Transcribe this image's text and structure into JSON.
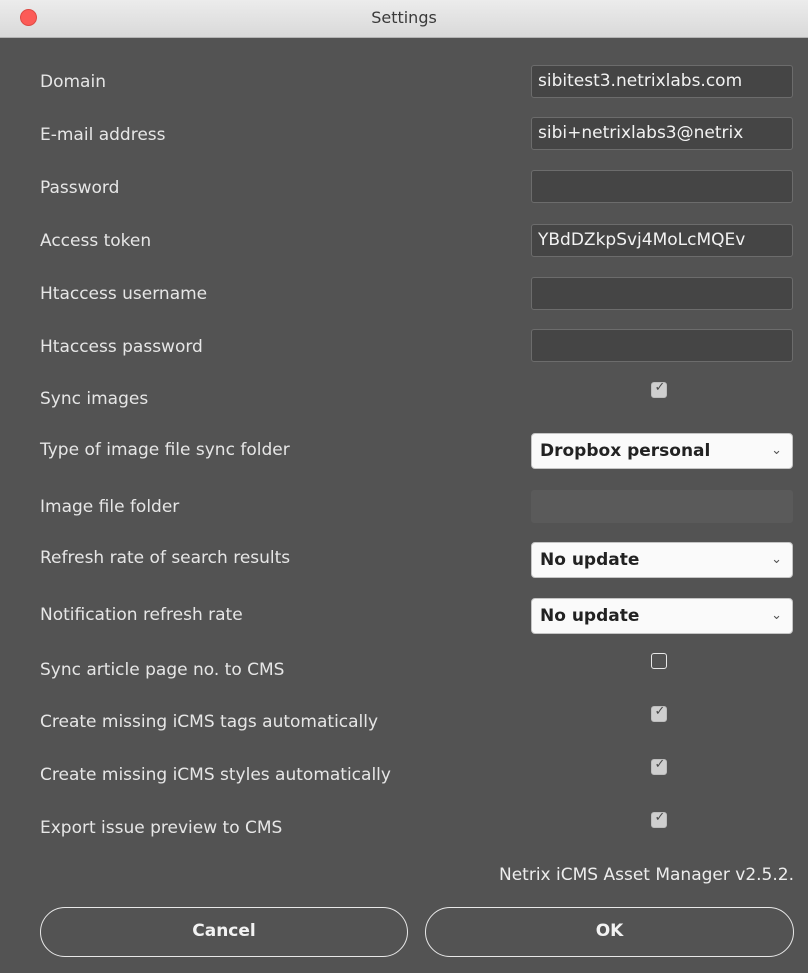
{
  "window": {
    "title": "Settings"
  },
  "fields": {
    "domain": {
      "label": "Domain",
      "value": "sibitest3.netrixlabs.com"
    },
    "email": {
      "label": "E-mail address",
      "value": "sibi+netrixlabs3@netrix"
    },
    "password": {
      "label": "Password",
      "value": ""
    },
    "access_token": {
      "label": "Access token",
      "value": "YBdDZkpSvj4MoLcMQEv"
    },
    "htaccess_username": {
      "label": "Htaccess username",
      "value": ""
    },
    "htaccess_password": {
      "label": "Htaccess password",
      "value": ""
    },
    "image_file_folder": {
      "label": "Image file folder",
      "value": ""
    }
  },
  "checkboxes": {
    "sync_images": {
      "label": "Sync images",
      "checked": true
    },
    "sync_article_page": {
      "label": "Sync article page no. to CMS",
      "checked": false
    },
    "create_tags": {
      "label": "Create missing iCMS tags automatically",
      "checked": true
    },
    "create_styles": {
      "label": "Create missing iCMS styles automatically",
      "checked": true
    },
    "export_preview": {
      "label": "Export issue preview to CMS",
      "checked": true
    }
  },
  "selects": {
    "sync_folder_type": {
      "label": "Type of image file sync folder",
      "value": "Dropbox personal"
    },
    "search_refresh": {
      "label": "Refresh rate of search results",
      "value": "No update"
    },
    "notification_refresh": {
      "label": "Notification refresh rate",
      "value": "No update"
    }
  },
  "footer": {
    "version": "Netrix iCMS Asset Manager v2.5.2.",
    "cancel_label": "Cancel",
    "ok_label": "OK"
  }
}
